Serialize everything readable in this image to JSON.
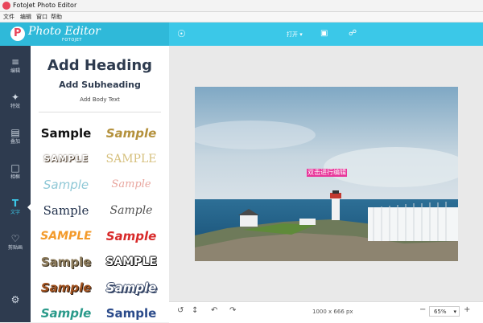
{
  "window": {
    "title": "FotoJet Photo Editor"
  },
  "menu": [
    "文件",
    "编辑",
    "窗口",
    "帮助"
  ],
  "brand": {
    "name": "Photo Editor",
    "sub": "FOTOJET"
  },
  "toolbar": {
    "open_label": "打开"
  },
  "sidebar": {
    "items": [
      {
        "icon": "sliders-icon",
        "label": "编辑"
      },
      {
        "icon": "magic-wand-icon",
        "label": "特效"
      },
      {
        "icon": "overlay-icon",
        "label": "叠加"
      },
      {
        "icon": "frame-icon",
        "label": "相框"
      },
      {
        "icon": "text-icon",
        "label": "文字"
      },
      {
        "icon": "heart-icon",
        "label": "剪贴画"
      },
      {
        "icon": "gear-icon",
        "label": ""
      }
    ]
  },
  "text_panel": {
    "heading": "Add Heading",
    "subheading": "Add Subheading",
    "body": "Add Body Text",
    "samples": [
      "Sample",
      "Sample",
      "SAMPLE",
      "SAMPLE",
      "Sample",
      "Sample",
      "Sample",
      "Sample",
      "SAMPLE",
      "Sample",
      "Sample",
      "SAMPLE",
      "Sample",
      "Sample",
      "Sample",
      "Sample"
    ]
  },
  "canvas": {
    "overlay_text": "双击进行编辑"
  },
  "status": {
    "dimensions": "1000 x 666 px",
    "zoom": "65%"
  },
  "colors": {
    "accent": "#3bc8e8",
    "sidebar": "#2e3b4f",
    "brand_red": "#e8455a"
  }
}
